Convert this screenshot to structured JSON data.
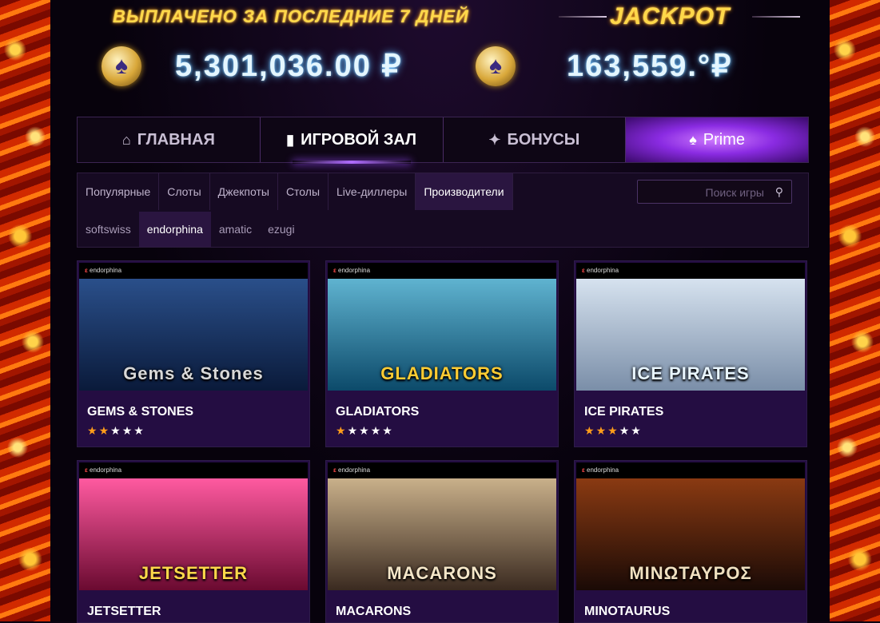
{
  "header": {
    "paid_title": "ВЫПЛАЧЕНО ЗА ПОСЛЕДНИЕ 7 ДНЕЙ",
    "paid_amount": "5,301,036.00 ₽",
    "jackpot_title": "JACKPOT",
    "jackpot_amount": "163,559.°₽"
  },
  "nav": {
    "items": [
      {
        "label": "ГЛАВНАЯ",
        "icon": "home-icon",
        "glyph": "⌂"
      },
      {
        "label": "ИГРОВОЙ ЗАЛ",
        "icon": "slot-icon",
        "glyph": "▮"
      },
      {
        "label": "БОНУСЫ",
        "icon": "gift-icon",
        "glyph": "✦"
      },
      {
        "label": "Prime",
        "icon": "spade-logo-icon",
        "glyph": "♠"
      }
    ]
  },
  "categories": {
    "tabs": [
      "Популярные",
      "Слоты",
      "Джекпоты",
      "Столы",
      "Live-диллеры",
      "Производители"
    ],
    "active_tab": "Производители",
    "search_placeholder": "Поиск игры",
    "providers": [
      "softswiss",
      "endorphina",
      "amatic",
      "ezugi"
    ],
    "active_provider": "endorphina"
  },
  "games": [
    {
      "name": "GEMS & STONES",
      "art_text": "Gems & Stones",
      "brand": "endorphina",
      "rating": 2,
      "colors": [
        "#0a1a3a",
        "#2a4f8a"
      ],
      "title_color": "#d8d8d8"
    },
    {
      "name": "GLADIATORS",
      "art_text": "GLADIATORS",
      "brand": "endorphina",
      "rating": 1,
      "colors": [
        "#0c4a6a",
        "#5fb3d0"
      ],
      "title_color": "#ffcc33"
    },
    {
      "name": "ICE PIRATES",
      "art_text": "ICE PIRATES",
      "brand": "endorphina",
      "rating": 3,
      "colors": [
        "#7a8ea8",
        "#d6e2ef"
      ],
      "title_color": "#e9f6ff"
    },
    {
      "name": "JETSETTER",
      "art_text": "JETSETTER",
      "brand": "endorphina",
      "rating": 0,
      "colors": [
        "#6a0a30",
        "#ff5aa0"
      ],
      "title_color": "#ffd84a"
    },
    {
      "name": "MACARONS",
      "art_text": "MACARONS",
      "brand": "endorphina",
      "rating": 0,
      "colors": [
        "#3a2a20",
        "#c9b08a"
      ],
      "title_color": "#f4e6c8"
    },
    {
      "name": "MINOTAURUS",
      "art_text": "ΜΙΝΩΤΑΥΡΟΣ",
      "brand": "endorphina",
      "rating": 0,
      "colors": [
        "#1a0a06",
        "#8a3a12"
      ],
      "title_color": "#f0e0c0"
    }
  ]
}
